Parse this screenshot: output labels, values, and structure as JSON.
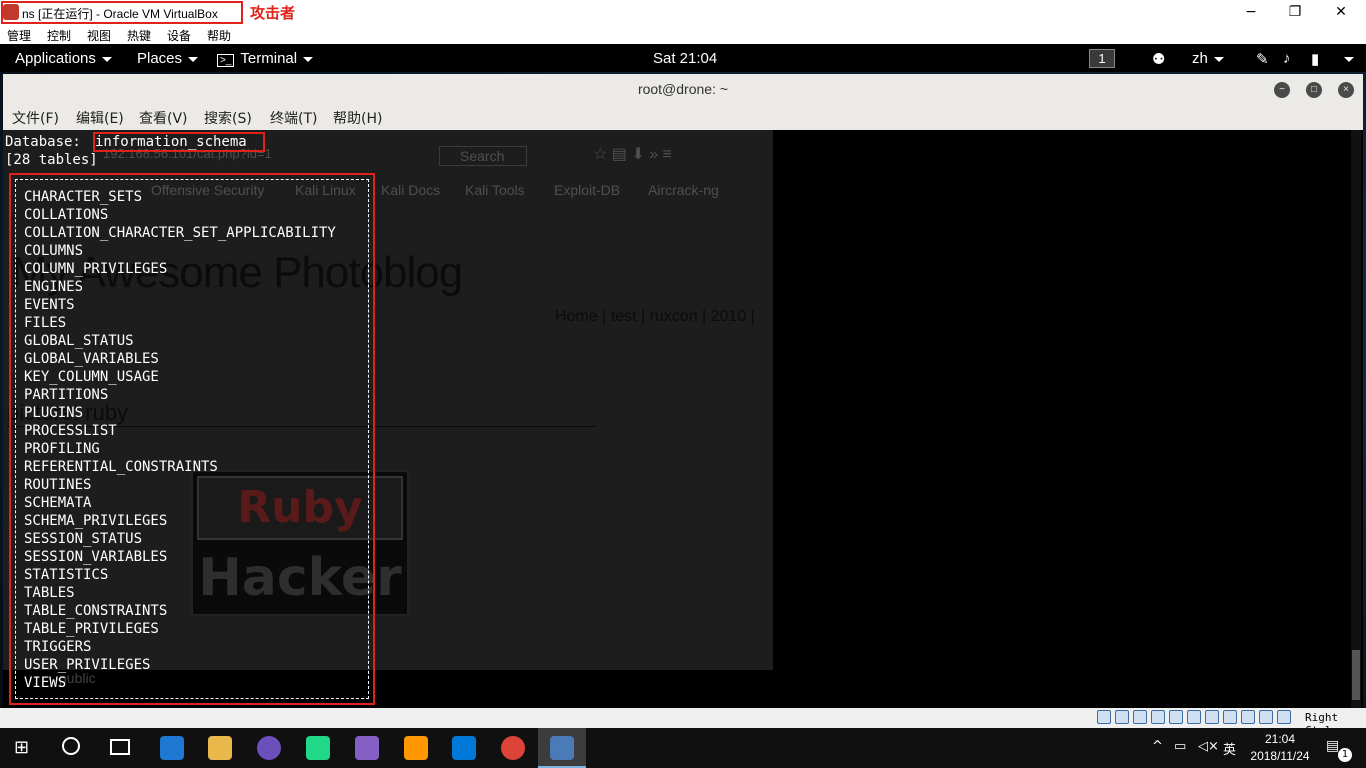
{
  "vbox": {
    "title": "ns [正在运行] - Oracle VM VirtualBox",
    "annotation": "攻击者",
    "minimize": "−",
    "maximize": "❐",
    "close": "✕",
    "menu": [
      "管理",
      "控制",
      "视图",
      "热键",
      "设备",
      "帮助"
    ],
    "status_right": "Right Ctrl"
  },
  "gnome": {
    "applications": "Applications",
    "places": "Places",
    "terminal": "Terminal",
    "clock": "Sat 21:04",
    "workspace": "1",
    "lang": "zh"
  },
  "terminal": {
    "title": "root@drone: ~",
    "menu": [
      "文件(F)",
      "编辑(E)",
      "查看(V)",
      "搜索(S)",
      "终端(T)",
      "帮助(H)"
    ],
    "db_label": "Database: ",
    "db_name": "information_schema",
    "table_count": "[28 tables]",
    "tables": [
      "CHARACTER_SETS",
      "COLLATIONS",
      "COLLATION_CHARACTER_SET_APPLICABILITY",
      "COLUMNS",
      "COLUMN_PRIVILEGES",
      "ENGINES",
      "EVENTS",
      "FILES",
      "GLOBAL_STATUS",
      "GLOBAL_VARIABLES",
      "KEY_COLUMN_USAGE",
      "PARTITIONS",
      "PLUGINS",
      "PROCESSLIST",
      "PROFILING",
      "REFERENTIAL_CONSTRAINTS",
      "ROUTINES",
      "SCHEMATA",
      "SCHEMA_PRIVILEGES",
      "SESSION_STATUS",
      "SESSION_VARIABLES",
      "STATISTICS",
      "TABLES",
      "TABLE_CONSTRAINTS",
      "TABLE_PRIVILEGES",
      "TRIGGERS",
      "USER_PRIVILEGES",
      "VIEWS"
    ]
  },
  "background_browser": {
    "url": "192.168.56.101/cat.php?id=1",
    "search_placeholder": "Search",
    "bookmarks": [
      "Offensive Security",
      "Kali Linux",
      "Kali Docs",
      "Kali Tools",
      "Exploit-DB",
      "Aircrack-ng"
    ],
    "site_title": "My Awesome Photoblog",
    "nav": "Home | test | ruxcon | 2010 |",
    "picture_title": "picture: ruby",
    "logo_top": "Ruby",
    "logo_bottom": "Hacker",
    "footer": "public"
  },
  "taskbar": {
    "time": "21:04",
    "date": "2018/11/24",
    "ime": "英",
    "notification_count": "1"
  }
}
